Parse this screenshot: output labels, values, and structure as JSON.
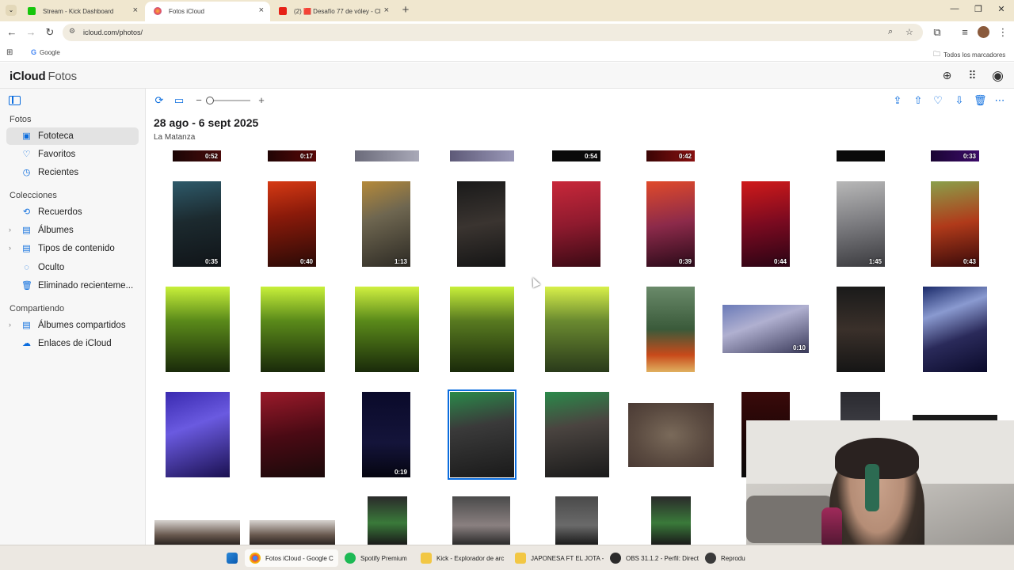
{
  "browser": {
    "tabs": [
      {
        "title": "Stream - Kick Dashboard",
        "favicon_color": "#16c60c",
        "active": false
      },
      {
        "title": "Fotos iCloud",
        "favicon_color": "#d9d9d9",
        "active": true
      },
      {
        "title": "(2) 🟥 Desafío 77 de vóley - Cl...",
        "favicon_color": "#e62117",
        "active": false
      }
    ],
    "url": "icloud.com/photos/",
    "bookmarks": {
      "google": "Google",
      "all": "Todos los marcadores"
    }
  },
  "app": {
    "brand": "iCloud",
    "section": "Fotos"
  },
  "sidebar": {
    "groups": [
      {
        "label": "Fotos",
        "items": [
          {
            "label": "Fototeca",
            "icon": "photo-library-icon",
            "active": true,
            "chevron": false
          },
          {
            "label": "Favoritos",
            "icon": "heart-icon",
            "active": false,
            "chevron": false
          },
          {
            "label": "Recientes",
            "icon": "clock-icon",
            "active": false,
            "chevron": false
          }
        ]
      },
      {
        "label": "Colecciones",
        "items": [
          {
            "label": "Recuerdos",
            "icon": "memories-icon",
            "active": false,
            "chevron": false
          },
          {
            "label": "Álbumes",
            "icon": "albums-icon",
            "active": false,
            "chevron": true
          },
          {
            "label": "Tipos de contenido",
            "icon": "media-types-icon",
            "active": false,
            "chevron": true
          },
          {
            "label": "Oculto",
            "icon": "eye-slash-icon",
            "active": false,
            "chevron": false
          },
          {
            "label": "Eliminado recienteme...",
            "icon": "trash-icon",
            "active": false,
            "chevron": false
          }
        ]
      },
      {
        "label": "Compartiendo",
        "items": [
          {
            "label": "Álbumes compartidos",
            "icon": "shared-albums-icon",
            "active": false,
            "chevron": true
          },
          {
            "label": "Enlaces de iCloud",
            "icon": "cloud-link-icon",
            "active": false,
            "chevron": false
          }
        ]
      }
    ]
  },
  "content": {
    "title": "28 ago - 6 sept 2025",
    "location": "La Matanza",
    "zoom_level": 0.0
  },
  "photos": {
    "row0_durations": [
      "0:52",
      "0:17",
      "",
      "",
      "0:54",
      "0:42",
      "",
      "",
      "0:33"
    ],
    "row1_durations": [
      "0:35",
      "0:40",
      "1:13",
      "",
      "",
      "0:39",
      "0:44",
      "1:45",
      "0:43"
    ],
    "row2_durations": [
      "",
      "",
      "",
      "",
      "",
      "",
      "0:10",
      "",
      ""
    ],
    "row3_durations": [
      "",
      "",
      "0:19",
      "",
      "",
      "",
      "",
      "",
      ""
    ]
  },
  "taskbar": {
    "items": [
      {
        "label": "Fotos iCloud - Google C",
        "color": "#4285f4",
        "active": true
      },
      {
        "label": "Spotify Premium",
        "color": "#1db954",
        "active": false
      },
      {
        "label": "Kick - Explorador de arc",
        "color": "#f2c744",
        "active": false
      },
      {
        "label": "JAPONESA FT EL JOTA -",
        "color": "#f2c744",
        "active": false
      },
      {
        "label": "OBS 31.1.2 - Perfil: Direct",
        "color": "#2b2b2b",
        "active": false
      },
      {
        "label": "Reprodu",
        "color": "#3a3a3a",
        "active": false
      }
    ]
  },
  "colors": {
    "accent": "#0a6cde",
    "tabbar": "#f0e7cf"
  }
}
